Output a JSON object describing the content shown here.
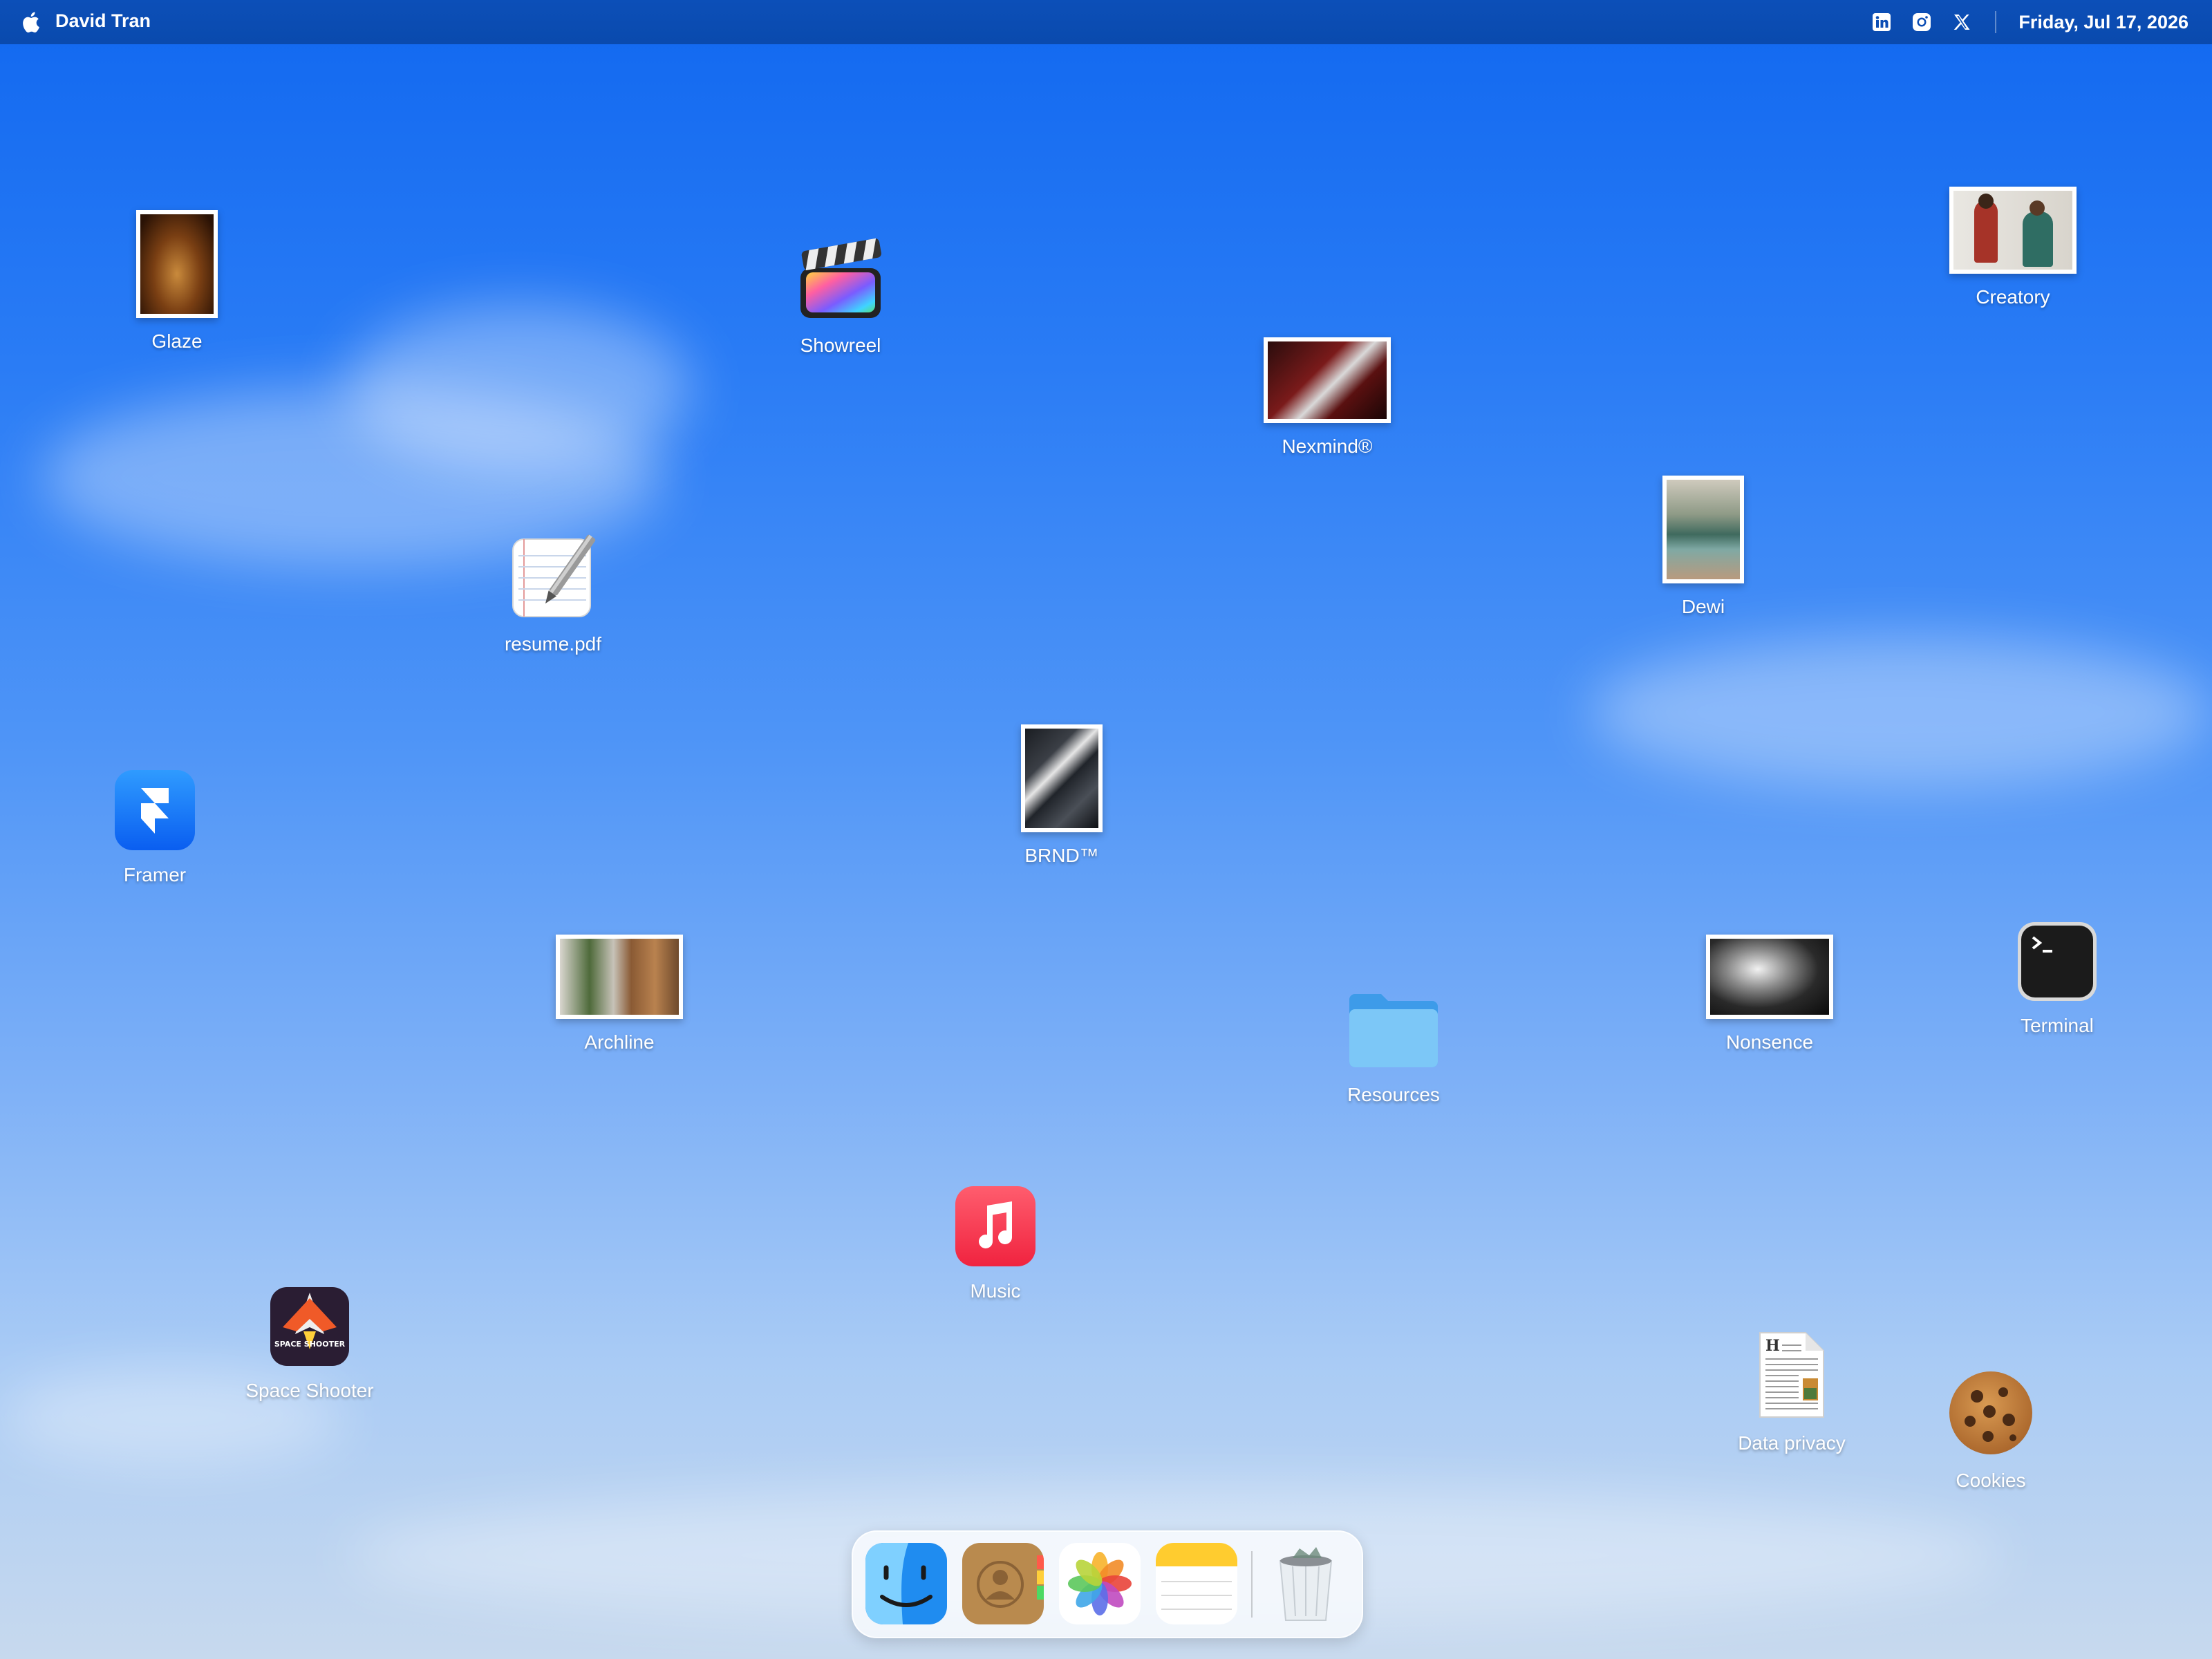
{
  "menubar": {
    "user_name": "David Tran",
    "date": "Friday, Jul 17, 2026",
    "social_icons": [
      "linkedin-icon",
      "instagram-icon",
      "x-icon"
    ]
  },
  "desktop": {
    "glaze": "Glaze",
    "showreel": "Showreel",
    "creatory": "Creatory",
    "nexmind": "Nexmind®",
    "dewi": "Dewi",
    "resume": "resume.pdf",
    "brnd": "BRND™",
    "framer": "Framer",
    "archline": "Archline",
    "resources": "Resources",
    "nonsence": "Nonsence",
    "terminal": "Terminal",
    "music": "Music",
    "space_shooter": "Space Shooter",
    "data_privacy": "Data privacy",
    "cookies": "Cookies"
  },
  "space_shooter_art": "SPACE SHOOTER",
  "dock": {
    "items": [
      "finder-icon",
      "contacts-icon",
      "photos-icon",
      "notes-icon",
      "trash-icon"
    ]
  },
  "colors": {
    "menubar": "#0a4aad",
    "sky_top": "#1168f0",
    "sky_bottom": "#c7d9ee"
  }
}
